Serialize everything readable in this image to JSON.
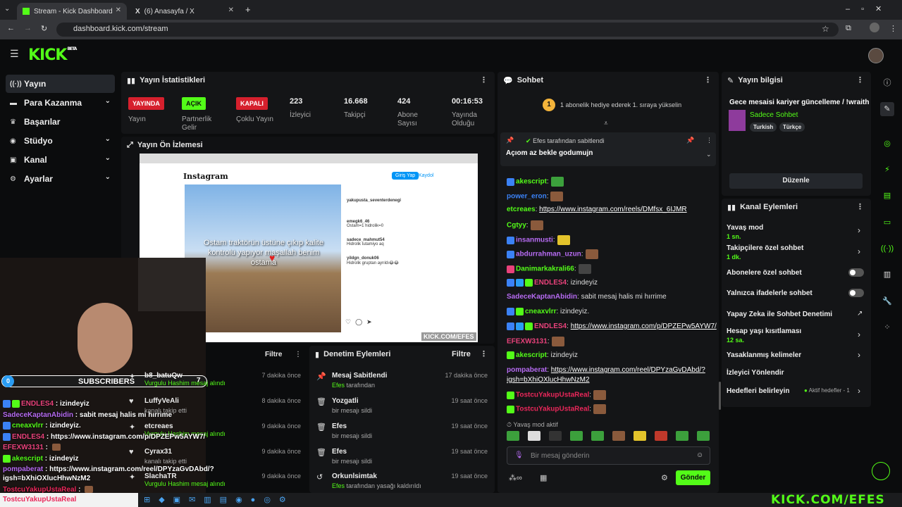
{
  "browser": {
    "tabs": [
      {
        "label": "Stream - Kick Dashboard"
      },
      {
        "label": "(6) Anasayfa / X"
      }
    ],
    "url": "dashboard.kick.com/stream"
  },
  "kick": {
    "logo": "KICK",
    "logo_sup": "BETA"
  },
  "sidebar": {
    "items": [
      {
        "label": "Yayın",
        "icon": "broadcast-icon"
      },
      {
        "label": "Para Kazanma",
        "icon": "money-icon"
      },
      {
        "label": "Başarılar",
        "icon": "trophy-icon"
      },
      {
        "label": "Stüdyo",
        "icon": "studio-icon"
      },
      {
        "label": "Kanal",
        "icon": "channel-icon"
      },
      {
        "label": "Ayarlar",
        "icon": "gear-icon"
      }
    ]
  },
  "stats": {
    "title": "Yayın İstatistikleri",
    "cards": [
      {
        "badge": "YAYINDA",
        "badge_color": "#d6202d",
        "label": "Yayın"
      },
      {
        "badge": "AÇIK",
        "badge_color": "#53fc18",
        "label": "Partnerlik Gelir"
      },
      {
        "badge": "KAPALI",
        "badge_color": "#d6202d",
        "label": "Çoklu Yayın"
      },
      {
        "value": "223",
        "label": "İzleyici"
      },
      {
        "value": "16.668",
        "label": "Takipçi"
      },
      {
        "value": "424",
        "label": "Abone Sayısı"
      },
      {
        "value": "00:16:53",
        "label": "Yayında Olduğu"
      }
    ]
  },
  "preview": {
    "title": "Yayın Ön İzlemesi",
    "ig_logo": "Instagram",
    "ig_login": "Giriş Yap",
    "ig_signup": "Kaydol",
    "caption": "Ostam traktörün üstüne çıkıp kalite kontrolü yapıyor maşallah benim ostama",
    "comments": [
      {
        "user": "yakupusta_seventerdenegi",
        "text": ""
      },
      {
        "user": "emegk6_46",
        "text": "Ostam=1 hidrolik=0"
      },
      {
        "user": "sadece_mahmut54",
        "text": "Hidrolik tutamiyo aq"
      },
      {
        "user": "yildgn_donuk06",
        "text": "Hidrolik gruptan ayrıldı😂😂"
      }
    ]
  },
  "activity": {
    "title": "",
    "filter": "Filtre",
    "items": [
      {
        "name": "b8_batuQw",
        "action": "Vurgulu Hashim mesaj alındı",
        "time": "7 dakika önce"
      },
      {
        "name": "LuffyVeAli",
        "action": "kanalı takip etti",
        "time": "8 dakika önce"
      },
      {
        "name": "etcreaes",
        "action": "Vurgulu Hashim mesaj alındı",
        "time": "9 dakika önce"
      },
      {
        "name": "Cyrax31",
        "action": "kanalı takip etti",
        "time": "9 dakika önce"
      },
      {
        "name": "SlachaTR",
        "action": "Vurgulu Hashim mesaj alındı",
        "time": "9 dakika önce"
      }
    ]
  },
  "moderation": {
    "title": "Denetim Eylemleri",
    "filter": "Filtre",
    "items": [
      {
        "name": "Mesaj Sabitlendi",
        "by": "Efes",
        "action": "tarafından",
        "time": "17 dakika önce",
        "icon": "pin-icon"
      },
      {
        "name": "Yozgatli",
        "by": "",
        "action": "bir mesajı sildi",
        "time": "19 saat önce",
        "icon": "trash-icon"
      },
      {
        "name": "Efes",
        "by": "",
        "action": "bir mesajı sildi",
        "time": "19 saat önce",
        "icon": "trash-icon"
      },
      {
        "name": "Efes",
        "by": "",
        "action": "bir mesajı sildi",
        "time": "19 saat önce",
        "icon": "trash-icon"
      },
      {
        "name": "Orkunlsimtak",
        "by": "Efes",
        "action": "tarafından yasağı kaldırıldı",
        "time": "19 saat önce",
        "icon": "undo-icon"
      }
    ]
  },
  "chat": {
    "title": "Sohbet",
    "goal": "1 abonelik hediye ederek 1. sıraya yükselin",
    "goal_num": "1",
    "pinned_by": "Efes tarafından sabitlendi",
    "pinned_text": "Açıom az bekle godumujn",
    "messages": [
      {
        "user": "akescript",
        "color": "#53fc18",
        "text": ""
      },
      {
        "user": "power_eron",
        "color": "#3b82f6",
        "text": ""
      },
      {
        "user": "etcreaes",
        "color": "#53fc18",
        "text": "https://www.instagram.com/reels/DMfsx_6IJMR"
      },
      {
        "user": "Cgtyy",
        "color": "#53fc18",
        "text": ""
      },
      {
        "user": "insanmusti",
        "color": "#b66bf2",
        "text": ""
      },
      {
        "user": "abdurrahman_uzun",
        "color": "#b66bf2",
        "text": ""
      },
      {
        "user": "Danimarkakrali66",
        "color": "#53fc18",
        "text": ""
      },
      {
        "user": "ENDLES4",
        "color": "#e9427b",
        "text": "izindeyiz"
      },
      {
        "user": "SadeceKaptanAbidin",
        "color": "#b66bf2",
        "text": "sabit mesaj halis mi hırrime"
      },
      {
        "user": "cneaxvlrr",
        "color": "#53fc18",
        "text": "izindeyiz."
      },
      {
        "user": "ENDLES4",
        "color": "#e9427b",
        "text": "https://www.instagram.com/p/DPZEPw5AYW7/"
      },
      {
        "user": "EFEXW3131",
        "color": "#e9427b",
        "text": ""
      },
      {
        "user": "akescript",
        "color": "#53fc18",
        "text": "izindeyiz"
      },
      {
        "user": "pompaberat",
        "color": "#b66bf2",
        "text": "https://www.instagram.com/reel/DPYzaGvDAbd/?"
      },
      {
        "user": "",
        "color": "#ffffff",
        "text": "igsh=bXhiOXlucHhwNzM2"
      },
      {
        "user": "TostcuYakupUstaReal",
        "color": "#e9275a",
        "text": ""
      },
      {
        "user": "TostcuYakupUstaReal",
        "color": "#e9275a",
        "text": ""
      }
    ],
    "slow_mode": "Yavaş mod aktif",
    "input_placeholder": "Bir mesaj gönderin",
    "send": "Gönder"
  },
  "stream_info": {
    "title": "Yayın bilgisi",
    "stream_title": "Gece mesaisi kariyer güncelleme / !wraith",
    "category": "Sadece Sohbet",
    "tags": [
      "Turkish",
      "Türkçe"
    ],
    "edit": "Düzenle"
  },
  "channel_actions": {
    "title": "Kanal Eylemleri",
    "items": [
      {
        "label": "Yavaş mod",
        "sub": "1 sn.",
        "control": "arrow"
      },
      {
        "label": "Takipçilere özel sohbet",
        "sub": "1 dk.",
        "control": "arrow"
      },
      {
        "label": "Abonelere özel sohbet",
        "sub": "",
        "control": "toggle"
      },
      {
        "label": "Yalnızca ifadelerle sohbet",
        "sub": "",
        "control": "toggle"
      },
      {
        "label": "Yapay Zeka ile Sohbet Denetimi",
        "sub": "",
        "control": "external"
      },
      {
        "label": "Hesap yaşı kısıtlaması",
        "sub": "12 sa.",
        "control": "arrow"
      },
      {
        "label": "Yasaklanmış kelimeler",
        "sub": "",
        "control": "arrow"
      },
      {
        "label": "İzleyici Yönlendir",
        "sub": "",
        "control": "none"
      },
      {
        "label": "Hedefleri belirleyin",
        "sub": "",
        "control": "arrow",
        "extra": "Aktif hedefler - 1"
      }
    ]
  },
  "overlay": {
    "subs_count": "0",
    "subs_label": "SUBSCRIBERS",
    "subs_goal": "7",
    "lines": [
      {
        "user": "ENDLES4",
        "text": "izindeyiz"
      },
      {
        "user": "SadeceKaptanAbidin",
        "text": "sabit mesaj halis mi hırrime"
      },
      {
        "user": "cneaxvlrr",
        "text": "izindeyiz."
      },
      {
        "user": "ENDLES4",
        "text": "https://www.instagram.com/p/DPZEPw5AYW7/"
      },
      {
        "user": "EFEXW3131",
        "text": ""
      },
      {
        "user": "akescript",
        "text": "izindeyiz"
      },
      {
        "user": "pompaberat",
        "text": "https://www.instagram.com/reel/DPYzaGvDAbd/?"
      },
      {
        "user": "",
        "text": "igsh=bXhiOXlucHhwNzM2"
      },
      {
        "user": "TostcuYakupUstaReal",
        "text": ""
      },
      {
        "user": "TostcuYakupUstaReal",
        "text": ""
      }
    ],
    "watermark": "KICK.COM/EFES",
    "preview_watermark": "KICK.COM/EFES"
  }
}
